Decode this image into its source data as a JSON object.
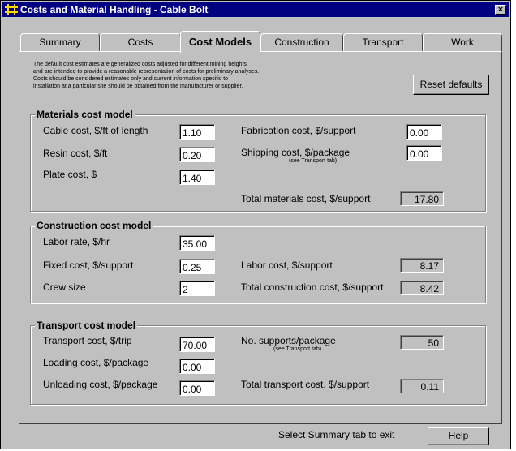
{
  "window": {
    "title": "Costs and Material Handling - Cable Bolt",
    "close_glyph": "×"
  },
  "tabs": [
    {
      "label": "Summary"
    },
    {
      "label": "Costs"
    },
    {
      "label": "Cost Models"
    },
    {
      "label": "Construction"
    },
    {
      "label": "Transport"
    },
    {
      "label": "Work"
    }
  ],
  "active_tab": "Cost Models",
  "notes": {
    "lines": [
      "The default cost estimates are generalized costs adjusted for different mining heights",
      "and are intended to provide a reasonable representation of costs for preliminary analyses.",
      "Costs should be considered estimates only and current information specific to",
      "installation at a particular site should be obtained from the manufacturer or supplier."
    ]
  },
  "reset_button": "Reset defaults",
  "materials": {
    "title": "Materials cost model",
    "cable_label": "Cable cost, $/ft of length",
    "cable_value": "1.10",
    "resin_label": "Resin cost, $/ft",
    "resin_value": "0.20",
    "plate_label": "Plate cost, $",
    "plate_value": "1.40",
    "fabrication_label": "Fabrication cost, $/support",
    "fabrication_value": "0.00",
    "shipping_label": "Shipping cost, $/package",
    "shipping_note": "(see Transport tab)",
    "shipping_value": "0.00",
    "total_label": "Total materials cost, $/support",
    "total_value": "17.80"
  },
  "construction": {
    "title": "Construction cost model",
    "labor_rate_label": "Labor rate, $/hr",
    "labor_rate_value": "35.00",
    "fixed_label": "Fixed cost, $/support",
    "fixed_value": "0.25",
    "crew_label": "Crew size",
    "crew_value": "2",
    "labor_cost_label": "Labor cost, $/support",
    "labor_cost_value": "8.17",
    "total_label": "Total construction cost, $/support",
    "total_value": "8.42"
  },
  "transport": {
    "title": "Transport cost model",
    "trip_label": "Transport cost, $/trip",
    "trip_value": "70.00",
    "loading_label": "Loading cost, $/package",
    "loading_value": "0.00",
    "unloading_label": "Unloading cost, $/package",
    "unloading_value": "0.00",
    "supports_label": "No. supports/package",
    "supports_note": "(see Transport tab)",
    "supports_value": "50",
    "total_label": "Total transport cost, $/support",
    "total_value": "0.11"
  },
  "footer": {
    "status": "Select Summary tab to exit",
    "help_button": "Help"
  }
}
